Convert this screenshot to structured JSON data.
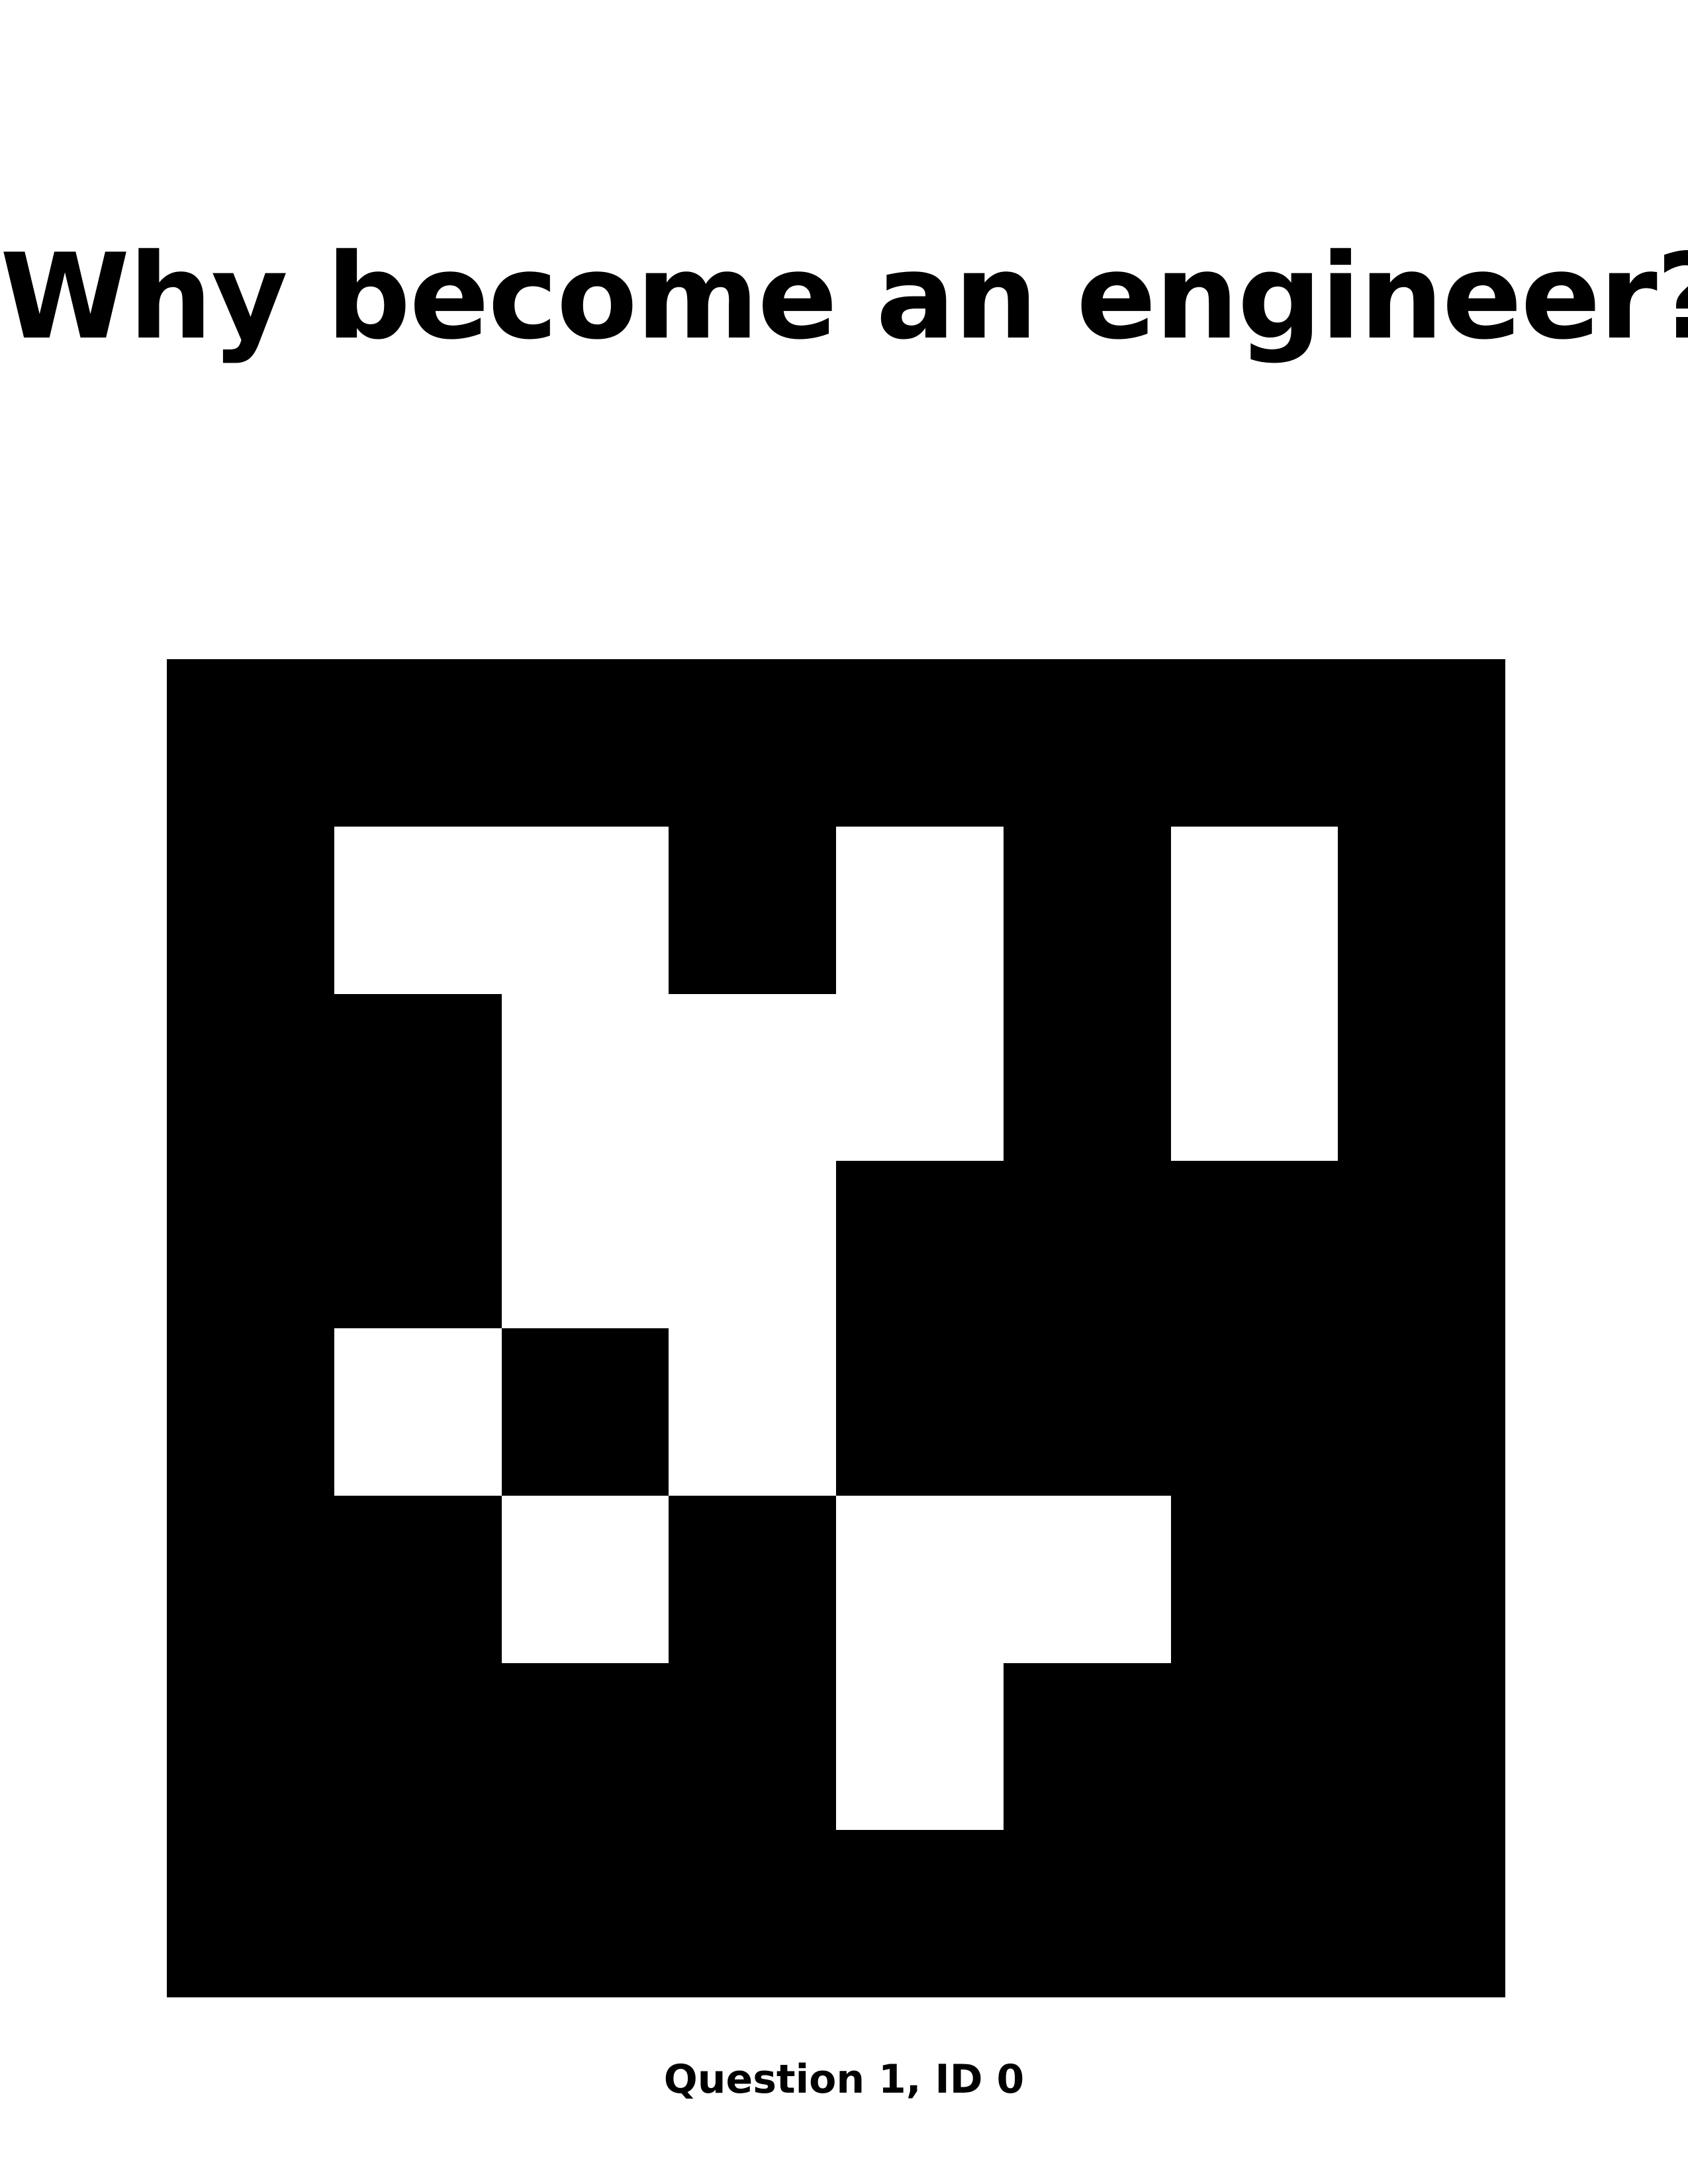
{
  "title": "Why become an engineer?",
  "marker": {
    "grid": [
      [
        0,
        0,
        0,
        0,
        0,
        0,
        0,
        0
      ],
      [
        0,
        1,
        1,
        0,
        1,
        0,
        1,
        0
      ],
      [
        0,
        0,
        1,
        1,
        1,
        0,
        1,
        0
      ],
      [
        0,
        0,
        1,
        1,
        0,
        0,
        0,
        0
      ],
      [
        0,
        1,
        0,
        1,
        0,
        0,
        0,
        0
      ],
      [
        0,
        0,
        1,
        0,
        1,
        1,
        0,
        0
      ],
      [
        0,
        0,
        0,
        0,
        1,
        0,
        0,
        0
      ],
      [
        0,
        0,
        0,
        0,
        0,
        0,
        0,
        0
      ]
    ],
    "colors": {
      "on": "#ffffff",
      "off": "#000000"
    }
  },
  "caption": "Question 1, ID 0"
}
